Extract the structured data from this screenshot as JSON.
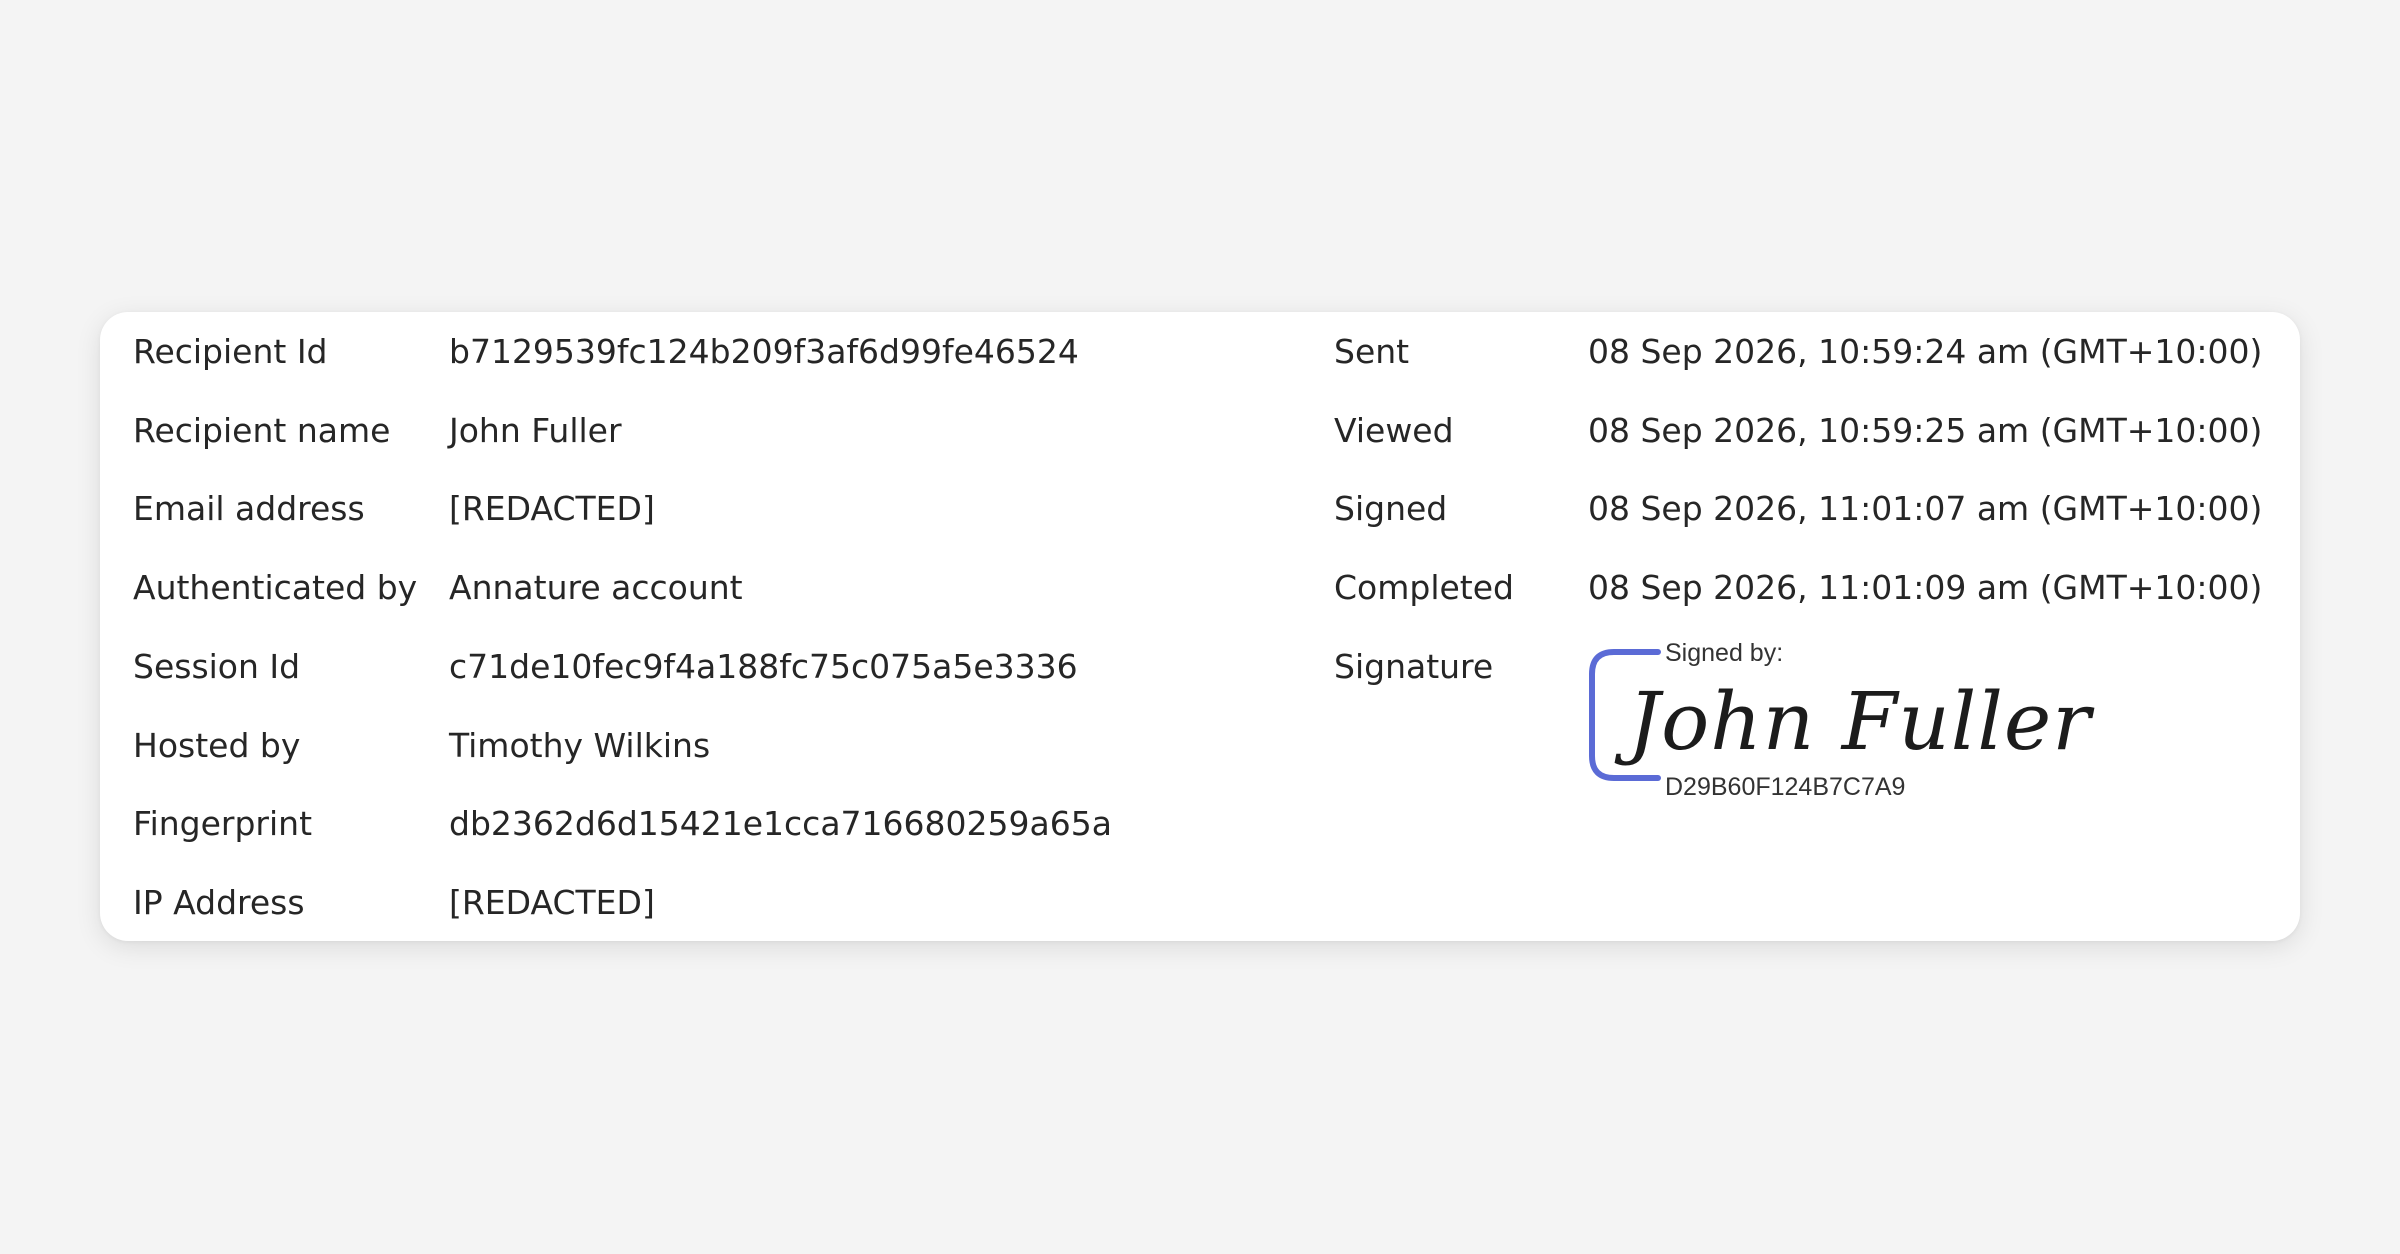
{
  "recipient": {
    "rows": [
      {
        "label": "Recipient Id",
        "value": "b7129539fc124b209f3af6d99fe46524"
      },
      {
        "label": "Recipient name",
        "value": "John Fuller"
      },
      {
        "label": "Email address",
        "value": "[REDACTED]"
      },
      {
        "label": "Authenticated by",
        "value": "Annature account"
      },
      {
        "label": "Session Id",
        "value": "c71de10fec9f4a188fc75c075a5e3336"
      },
      {
        "label": "Hosted by",
        "value": "Timothy Wilkins"
      },
      {
        "label": "Fingerprint",
        "value": "db2362d6d15421e1cca716680259a65a"
      },
      {
        "label": "IP Address",
        "value": "[REDACTED]"
      }
    ]
  },
  "events": {
    "rows": [
      {
        "label": "Sent",
        "value": "08 Sep 2026, 10:59:24 am (GMT+10:00)"
      },
      {
        "label": "Viewed",
        "value": "08 Sep 2026, 10:59:25 am (GMT+10:00)"
      },
      {
        "label": "Signed",
        "value": "08 Sep 2026, 11:01:07 am (GMT+10:00)"
      },
      {
        "label": "Completed",
        "value": "08 Sep 2026, 11:01:09 am (GMT+10:00)"
      }
    ],
    "signature_label": "Signature"
  },
  "signature": {
    "caption": "Signed by:",
    "name": "John Fuller",
    "id": "D29B60F124B7C7A9",
    "bracket_color": "#5b6bd6"
  }
}
